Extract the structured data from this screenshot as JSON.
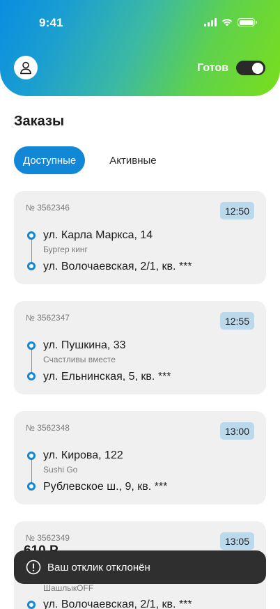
{
  "status_bar": {
    "time": "9:41"
  },
  "header": {
    "ready_label": "Готов",
    "ready_on": true
  },
  "page": {
    "title": "Заказы"
  },
  "tabs": [
    {
      "label": "Доступные",
      "active": true
    },
    {
      "label": "Активные",
      "active": false
    }
  ],
  "orders": [
    {
      "number": "№ 3562346",
      "time": "12:50",
      "from": "ул. Карла Маркса, 14",
      "place": "Бургер кинг",
      "to": "ул. Волочаевская, 2/1, кв. ***"
    },
    {
      "number": "№ 3562347",
      "time": "12:55",
      "from": "ул. Пушкина, 33",
      "place": "Счастливы вместе",
      "to": "ул. Ельнинская, 5, кв. ***"
    },
    {
      "number": "№ 3562348",
      "time": "13:00",
      "from": "ул. Кирова, 122",
      "place": "Sushi Go",
      "to": "Рублевское ш., 9, кв. ***"
    },
    {
      "number": "№ 3562349",
      "time": "13:05",
      "partial_text": "610 Р",
      "place": "ШашлыкOFF",
      "to": "ул. Волочаевская, 2/1, кв. ***"
    }
  ],
  "toast": {
    "text": "Ваш отклик отклонён"
  },
  "colors": {
    "accent": "#1287d6",
    "badge": "#bcd9ec",
    "card": "#f0f0f0",
    "toast": "#2f2f2f"
  }
}
